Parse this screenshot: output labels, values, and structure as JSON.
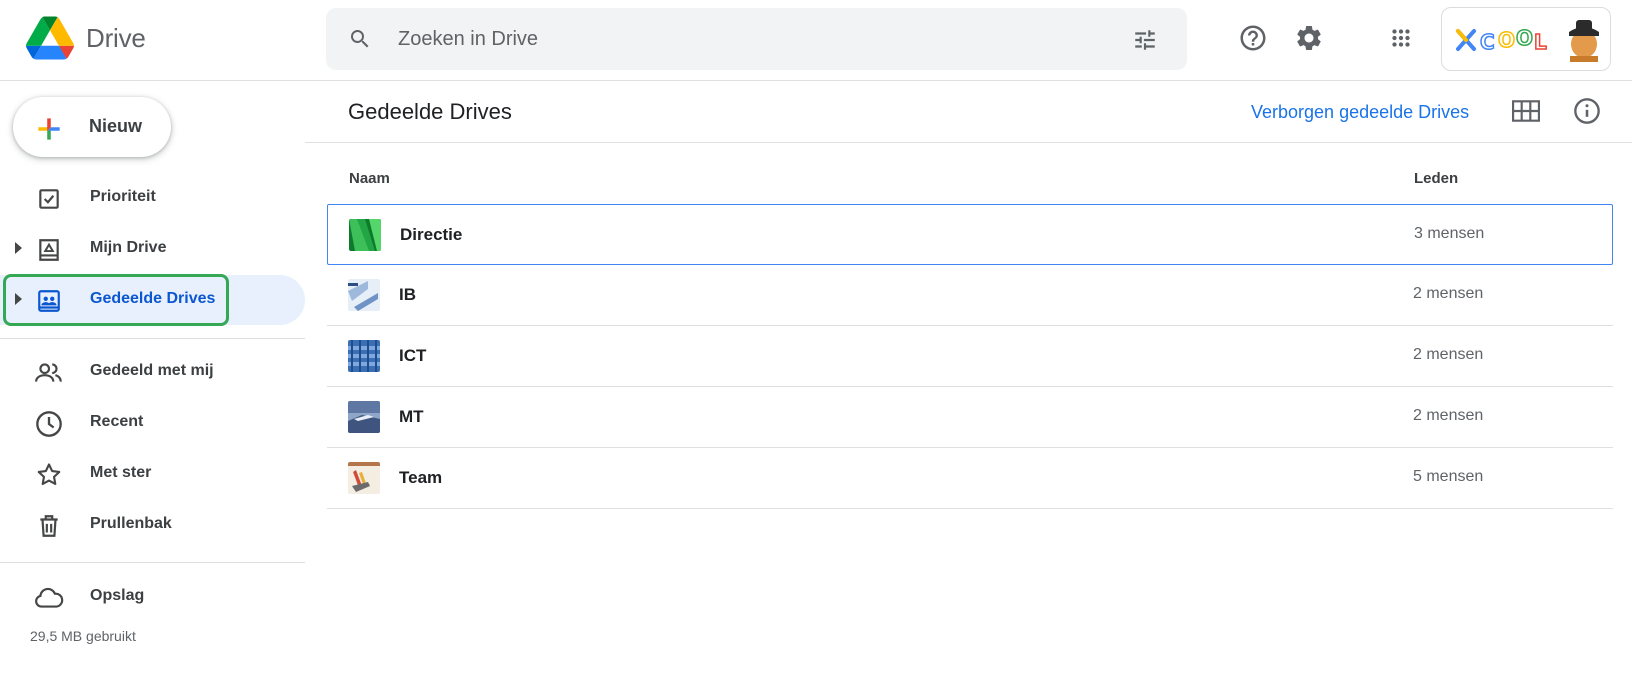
{
  "header": {
    "app_name": "Drive",
    "search_placeholder": "Zoeken in Drive",
    "icons": [
      "search-icon",
      "tune-icon",
      "help-icon",
      "settings-icon",
      "apps-icon"
    ],
    "org_logo": "XCOOL"
  },
  "sidebar": {
    "new_button": "Nieuw",
    "items": [
      {
        "label": "Prioriteit",
        "icon": "priority-icon"
      },
      {
        "label": "Mijn Drive",
        "icon": "my-drive-icon"
      },
      {
        "label": "Gedeelde Drives",
        "icon": "shared-drives-icon",
        "active": true
      },
      {
        "label": "Gedeeld met mij",
        "icon": "shared-with-me-icon"
      },
      {
        "label": "Recent",
        "icon": "clock-icon"
      },
      {
        "label": "Met ster",
        "icon": "star-icon"
      },
      {
        "label": "Prullenbak",
        "icon": "trash-icon"
      },
      {
        "label": "Opslag",
        "icon": "cloud-icon"
      }
    ],
    "storage_used": "29,5 MB gebruikt"
  },
  "main": {
    "title": "Gedeelde Drives",
    "hidden_link": "Verborgen gedeelde Drives",
    "columns": {
      "name": "Naam",
      "members": "Leden"
    },
    "rows": [
      {
        "name": "Directie",
        "members": "3 mensen"
      },
      {
        "name": "IB",
        "members": "2 mensen"
      },
      {
        "name": "ICT",
        "members": "2 mensen"
      },
      {
        "name": "MT",
        "members": "2 mensen"
      },
      {
        "name": "Team",
        "members": "5 mensen"
      }
    ]
  },
  "colors": {
    "accent": "#1a73e8",
    "active_bg": "#e8f0fe",
    "active_text": "#0b57d0",
    "highlight_border": "#34a853"
  }
}
